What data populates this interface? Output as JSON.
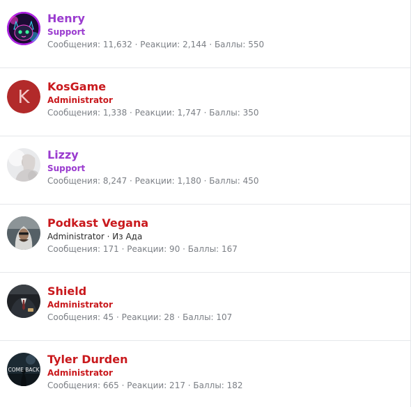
{
  "colors": {
    "support": "#9a3bcf",
    "administrator": "#c9191d",
    "stats_text": "#7b7f85",
    "divider": "#e5e7ea"
  },
  "members": [
    {
      "name": "Henry",
      "role": "Support",
      "stats": "Сообщения: 11,632 · Реакции: 2,144 · Баллы: 550",
      "avatar": "cat-neon-avatar"
    },
    {
      "name": "KosGame",
      "role": "Administrator",
      "letter": "K",
      "stats": "Сообщения: 1,338 · Реакции: 1,747 · Баллы: 350",
      "avatar": "letter-avatar"
    },
    {
      "name": "Lizzy",
      "role": "Support",
      "stats": "Сообщения: 8,247 · Реакции: 1,180 · Баллы: 450",
      "avatar": "girl-photo-avatar"
    },
    {
      "name": "Podkast Vegana",
      "role": "Administrator",
      "separator": "·",
      "location": "Из Ада",
      "stats": "Сообщения: 171 · Реакции: 90 · Баллы: 167",
      "avatar": "hooded-man-avatar"
    },
    {
      "name": "Shield",
      "role": "Administrator",
      "stats": "Сообщения: 45 · Реакции: 28 · Баллы: 107",
      "avatar": "suit-man-avatar"
    },
    {
      "name": "Tyler Durden",
      "role": "Administrator",
      "avatar_text": "COME BACK",
      "stats": "Сообщения: 665 · Реакции: 217 · Баллы: 182",
      "avatar": "come-back-avatar"
    }
  ]
}
